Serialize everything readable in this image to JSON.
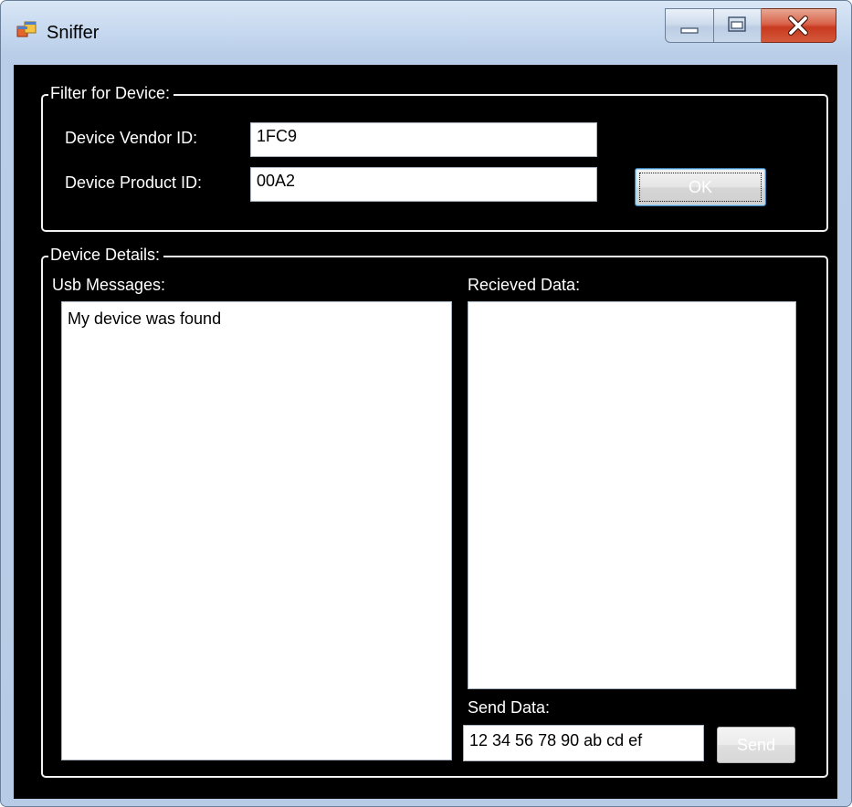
{
  "window": {
    "title": "Sniffer",
    "icon": "app-window-icon",
    "controls": [
      "minimize-icon",
      "maximize-icon",
      "close-icon"
    ]
  },
  "filter_group": {
    "title": "Filter for Device:",
    "vendor_label": "Device Vendor ID:",
    "vendor_value": "1FC9",
    "product_label": "Device Product ID:",
    "product_value": "00A2",
    "ok_label": "OK"
  },
  "details_group": {
    "title": "Device Details:",
    "usb_messages_label": "Usb Messages:",
    "usb_messages": [
      "My device was found"
    ],
    "received_label": "Recieved Data:",
    "send_label": "Send Data:",
    "send_value": "12 34 56 78 90 ab cd ef",
    "send_button": "Send"
  },
  "colors": {
    "client_background": "#000000",
    "close_button": "#c83a20",
    "title_bar": "#c3d6ee"
  }
}
